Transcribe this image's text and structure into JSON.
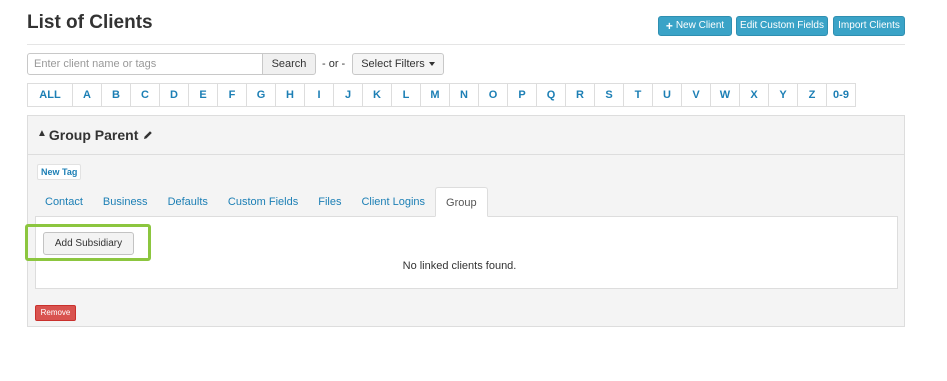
{
  "page": {
    "title": "List of Clients"
  },
  "header_buttons": {
    "new_client": "New Client",
    "edit_custom_fields": "Edit Custom Fields",
    "import_clients": "Import Clients"
  },
  "search": {
    "placeholder": "Enter client name or tags",
    "value": "",
    "button": "Search",
    "or_text": "- or -",
    "filters_button": "Select Filters"
  },
  "alphabet": [
    "ALL",
    "A",
    "B",
    "C",
    "D",
    "E",
    "F",
    "G",
    "H",
    "I",
    "J",
    "K",
    "L",
    "M",
    "N",
    "O",
    "P",
    "Q",
    "R",
    "S",
    "T",
    "U",
    "V",
    "W",
    "X",
    "Y",
    "Z",
    "0-9"
  ],
  "group": {
    "title": "Group Parent",
    "new_tag": "New Tag",
    "tabs": [
      "Contact",
      "Business",
      "Defaults",
      "Custom Fields",
      "Files",
      "Client Logins",
      "Group"
    ],
    "active_tab": "Group",
    "add_subsidiary": "Add Subsidiary",
    "empty_message": "No linked clients found.",
    "remove": "Remove"
  },
  "colors": {
    "accent": "#3aa3c7",
    "link": "#1c7fb5",
    "highlight": "#8cc63f",
    "danger": "#d9534f"
  },
  "icons": {
    "new_client": "plus-icon",
    "title_toggle": "caret-up-icon",
    "edit": "pencil-icon",
    "filters": "caret-down-icon"
  }
}
